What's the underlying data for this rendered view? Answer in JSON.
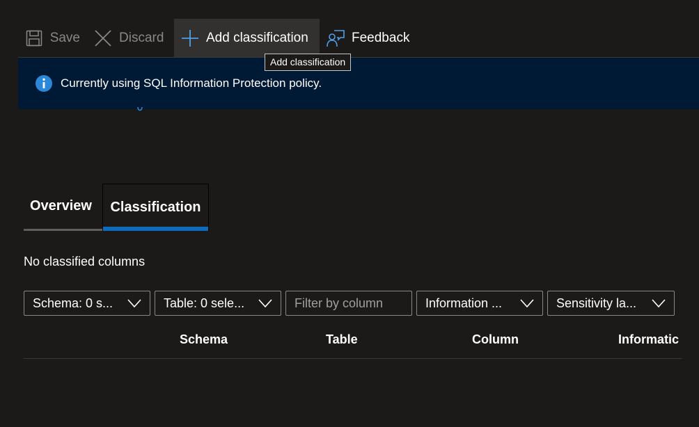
{
  "toolbar": {
    "save_label": "Save",
    "discard_label": "Discard",
    "add_label": "Add classification",
    "feedback_label": "Feedback"
  },
  "tooltip": {
    "text": "Add classification"
  },
  "banner": {
    "message": "Currently using SQL Information Protection policy."
  },
  "tabs": [
    {
      "label": "Overview",
      "selected": false
    },
    {
      "label": "Classification",
      "selected": true
    }
  ],
  "content": {
    "empty_message": "No classified columns"
  },
  "filters": {
    "schema": "Schema: 0 s...",
    "table": "Table: 0 sele...",
    "column_placeholder": "Filter by column",
    "information": "Information ...",
    "sensitivity": "Sensitivity la..."
  },
  "table": {
    "columns": [
      "Schema",
      "Table",
      "Column",
      "Informatic"
    ]
  },
  "colors": {
    "background": "#1b1a19",
    "banner": "#001a36",
    "accent": "#0f6cbd",
    "info_icon": "#2b88d8"
  }
}
